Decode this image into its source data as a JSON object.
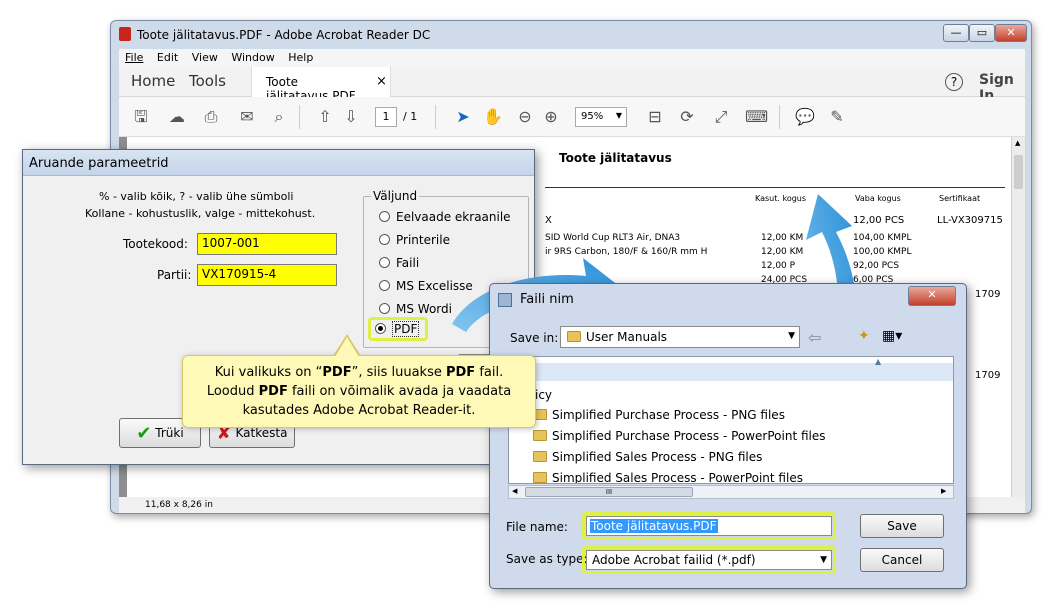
{
  "acrobat": {
    "title": "Toote jälitatavus.PDF - Adobe Acrobat Reader DC",
    "menu": [
      "File",
      "Edit",
      "View",
      "Window",
      "Help"
    ],
    "tabs": {
      "home": "Home",
      "tools": "Tools",
      "document": "Toote jälitatavus.PDF",
      "close": "×"
    },
    "help_icon": "?",
    "sign_in": "Sign In",
    "page_current": "1",
    "page_total": "/ 1",
    "zoom": "95%",
    "status": "11,68 x 8,26 in",
    "doc": {
      "title": "Toote jälitatavus",
      "columns": [
        "Kasut. kogus",
        "Vaba kogus",
        "Sertifikaat"
      ],
      "rows": [
        {
          "name": "X",
          "used": "",
          "free": "12,00 PCS",
          "cert": "LL-VX309715"
        },
        {
          "name": "SID World Cup RLT3 Air, DNA3",
          "used": "12,00 KM",
          "free": "104,00 KMPL",
          "cert": ""
        },
        {
          "name": "ir 9RS Carbon, 180/F & 160/R mm H",
          "used": "12,00 KM",
          "free": "100,00 KMPL",
          "cert": ""
        },
        {
          "name": "",
          "used": "12,00 P",
          "free": "92,00 PCS",
          "cert": ""
        },
        {
          "name": "",
          "used": "24,00 PCS",
          "free": "6,00 PCS",
          "cert": ""
        }
      ],
      "side_values": [
        "1709",
        "1709"
      ]
    }
  },
  "report_dialog": {
    "title": "Aruande parameetrid",
    "hint_line1": "% - valib kõik, ? - valib ühe sümboli",
    "hint_line2": "Kollane - kohustuslik, valge - mittekohust.",
    "product_label": "Tootekood:",
    "product_value": "1007-001",
    "batch_label": "Partii:",
    "batch_value": "VX170915-4",
    "output_label": "Väljund",
    "output_options": [
      "Eelvaade ekraanile",
      "Printerile",
      "Faili",
      "MS Excelisse",
      "MS Wordi",
      "PDF"
    ],
    "selected_output": "PDF",
    "print_button": "Trüki",
    "cancel_button": "Katkesta"
  },
  "callout": {
    "part1": "Kui valikuks on “",
    "bold1": "PDF",
    "part2": "”, siis luuakse ",
    "bold2": "PDF",
    "part3": " fail.",
    "part4": "Loodud ",
    "bold3": "PDF",
    "part5": " faili on võimalik avada ja vaadata",
    "line3": "kasutades Adobe Acrobat Reader-it."
  },
  "save_dialog": {
    "title": "Faili nim",
    "save_in_label": "Save in:",
    "save_in_value": "User Manuals",
    "partial_item": "icy",
    "items": [
      "Simplified Purchase Process - PNG files",
      "Simplified Purchase Process - PowerPoint files",
      "Simplified Sales Process - PNG files",
      "Simplified Sales Process - PowerPoint files"
    ],
    "filename_label": "File name:",
    "filename_value": "Toote jälitatavus.PDF",
    "type_label": "Save as type:",
    "type_value": "Adobe Acrobat failid (*.pdf)",
    "save_button": "Save",
    "cancel_button": "Cancel",
    "scroll_mark": "III"
  },
  "colors": {
    "highlight": "#ddf043",
    "required_field": "#ffff00",
    "arrow": "#3a9be0",
    "callout_bg": "#fff9b8"
  }
}
